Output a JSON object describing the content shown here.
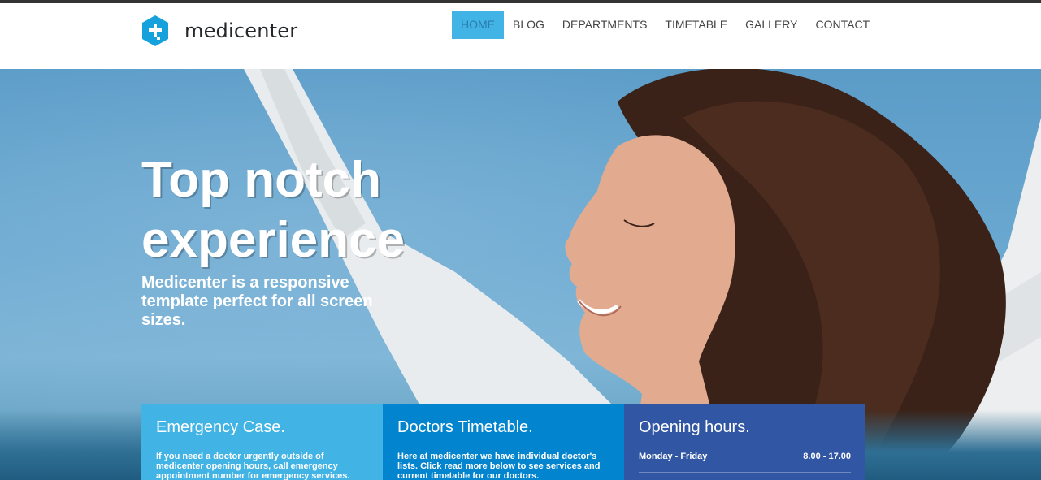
{
  "brand": {
    "name": "medicenter",
    "accent": "#42b3e5",
    "icon": "plus-hexagon-icon"
  },
  "nav": {
    "items": [
      {
        "label": "HOME",
        "active": true
      },
      {
        "label": "BLOG",
        "active": false
      },
      {
        "label": "DEPARTMENTS",
        "active": false
      },
      {
        "label": "TIMETABLE",
        "active": false
      },
      {
        "label": "GALLERY",
        "active": false
      },
      {
        "label": "CONTACT",
        "active": false
      }
    ]
  },
  "hero": {
    "title_line1": "Top notch",
    "title_line2": "experience",
    "subtitle": "Medicenter is a responsive template perfect for all screen sizes."
  },
  "boxes": {
    "emergency": {
      "title": "Emergency Case.",
      "text": "If you need a doctor urgently outside of medicenter opening hours, call emergency appointment number for emergency services.",
      "color": "#42b3e5"
    },
    "timetable": {
      "title": "Doctors Timetable.",
      "text": "Here at medicenter we have individual doctor's lists. Click read more below to see services and current timetable for our doctors.",
      "color": "#0384ce"
    },
    "hours": {
      "title": "Opening hours.",
      "rows": [
        {
          "day": "Monday - Friday",
          "time": "8.00 - 17.00"
        }
      ],
      "color": "#3156a3"
    }
  }
}
